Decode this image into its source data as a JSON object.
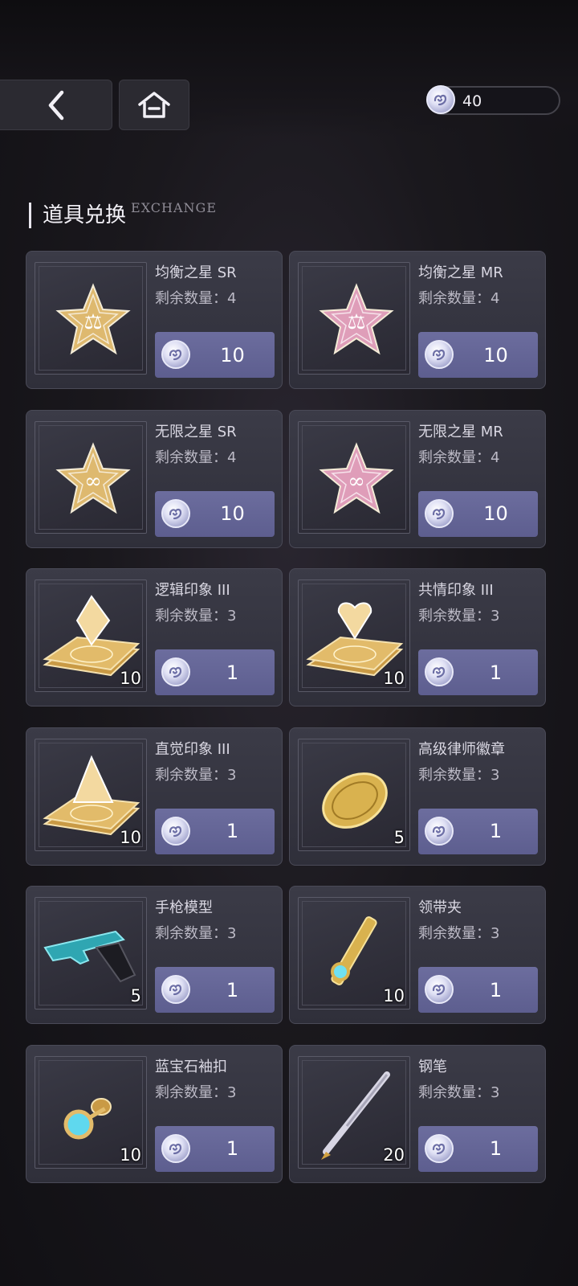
{
  "header": {
    "back_icon": "chevron-left-icon",
    "home_icon": "home-icon",
    "currency": {
      "icon": "exchange-token-icon",
      "amount": "40"
    }
  },
  "section": {
    "title": "道具兑换",
    "subtitle": "EXCHANGE"
  },
  "items": [
    {
      "name": "均衡之星 SR",
      "remain": "剩余数量：4",
      "price": "10",
      "qty": "",
      "icon": "balance-star-sr-icon"
    },
    {
      "name": "均衡之星 MR",
      "remain": "剩余数量：4",
      "price": "10",
      "qty": "",
      "icon": "balance-star-mr-icon"
    },
    {
      "name": "无限之星 SR",
      "remain": "剩余数量：4",
      "price": "10",
      "qty": "",
      "icon": "infinity-star-sr-icon"
    },
    {
      "name": "无限之星 MR",
      "remain": "剩余数量：4",
      "price": "10",
      "qty": "",
      "icon": "infinity-star-mr-icon"
    },
    {
      "name": "逻辑印象 III",
      "remain": "剩余数量：3",
      "price": "1",
      "qty": "10",
      "icon": "logic-impression-icon"
    },
    {
      "name": "共情印象 III",
      "remain": "剩余数量：3",
      "price": "1",
      "qty": "10",
      "icon": "empathy-impression-icon"
    },
    {
      "name": "直觉印象 III",
      "remain": "剩余数量：3",
      "price": "1",
      "qty": "10",
      "icon": "intuition-impression-icon"
    },
    {
      "name": "高级律师徽章",
      "remain": "剩余数量：3",
      "price": "1",
      "qty": "5",
      "icon": "lawyer-badge-icon"
    },
    {
      "name": "手枪模型",
      "remain": "剩余数量：3",
      "price": "1",
      "qty": "5",
      "icon": "pistol-model-icon"
    },
    {
      "name": "领带夹",
      "remain": "剩余数量：3",
      "price": "1",
      "qty": "10",
      "icon": "tie-clip-icon"
    },
    {
      "name": "蓝宝石袖扣",
      "remain": "剩余数量：3",
      "price": "1",
      "qty": "10",
      "icon": "sapphire-cufflink-icon"
    },
    {
      "name": "钢笔",
      "remain": "剩余数量：3",
      "price": "1",
      "qty": "20",
      "icon": "fountain-pen-icon"
    }
  ],
  "colors": {
    "gold": "#e8c172",
    "pink": "#e9a4c0",
    "button": "#6c6d9e",
    "card": "#363642"
  }
}
